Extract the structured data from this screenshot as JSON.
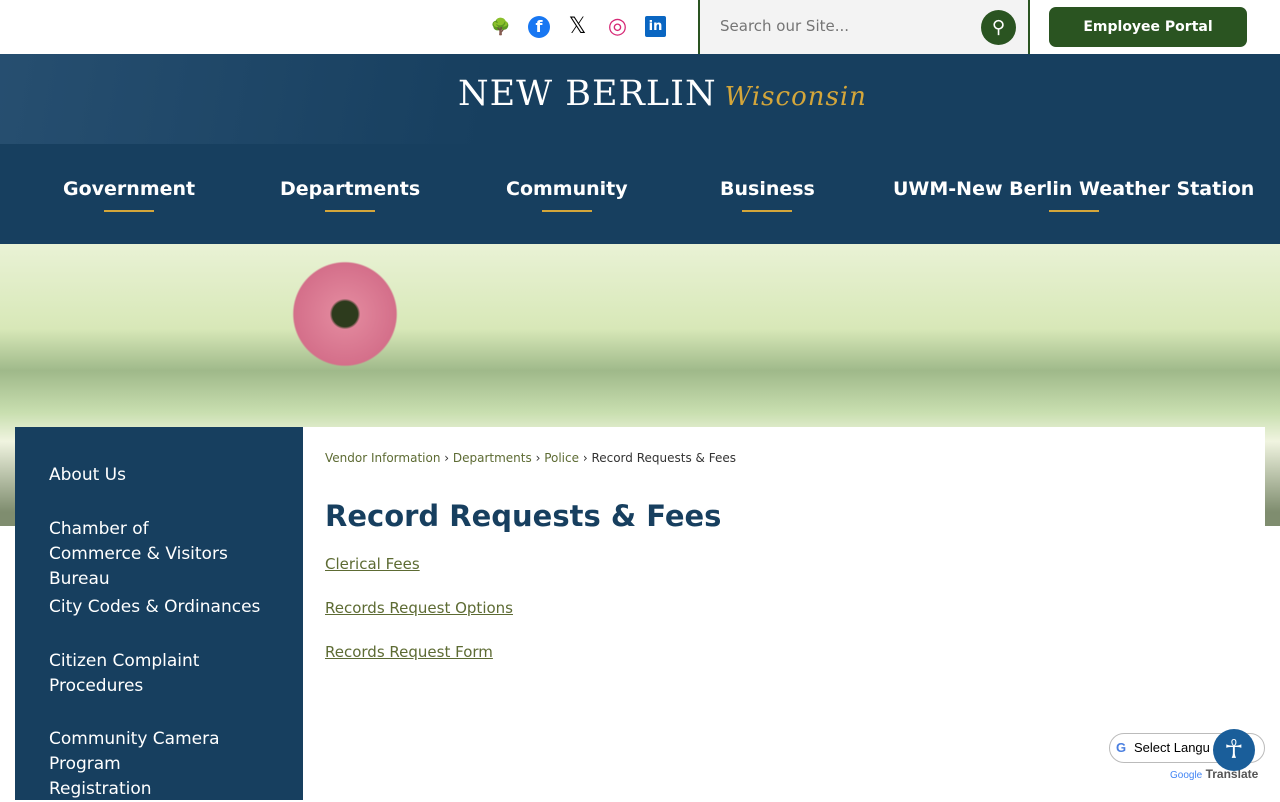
{
  "topbar": {
    "social": [
      {
        "icon": "tree-icon",
        "glyph": "🌳"
      },
      {
        "icon": "facebook-icon",
        "glyph": "f"
      },
      {
        "icon": "x-icon",
        "glyph": "𝕏"
      },
      {
        "icon": "instagram-icon",
        "glyph": "◎"
      },
      {
        "icon": "linkedin-icon",
        "glyph": "in"
      }
    ],
    "search_placeholder": "Search our Site...",
    "employee_portal": "Employee Portal"
  },
  "header": {
    "logo_main": "NEW BERLIN",
    "logo_script": "Wisconsin"
  },
  "nav": [
    "Government",
    "Departments",
    "Community",
    "Business",
    "UWM-New Berlin Weather Station"
  ],
  "sidebar": [
    "About Us",
    "Chamber of Commerce & Visitors Bureau",
    "City Codes & Ordinances",
    "Citizen Complaint Procedures",
    "Community Camera Program Registration"
  ],
  "breadcrumb": [
    "Vendor Information",
    "Departments",
    "Police",
    "Record Requests & Fees"
  ],
  "main": {
    "title": "Record Requests & Fees",
    "links": [
      "Clerical Fees",
      "Records Request Options",
      "Records Request Form"
    ]
  },
  "translate": {
    "label": "Select Langu",
    "powered": "Google",
    "translate": "Translate"
  },
  "colors": {
    "navy": "#173f5f",
    "green": "#2a5421",
    "gold": "#d4a63a"
  }
}
